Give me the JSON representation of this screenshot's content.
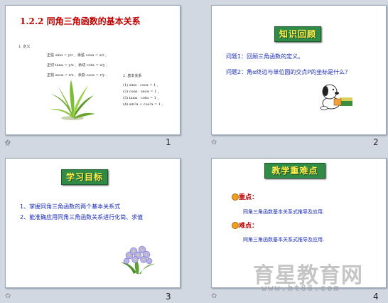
{
  "slides": [
    {
      "number": "1",
      "title": "1.2.2 同角三角函数的基本关系",
      "section1_label": "1. 定义",
      "definitions": [
        [
          "正弦 sinα = y/r ,",
          "余弦 cosα = x/r ,"
        ],
        [
          "正切 tanα = y/x ,",
          "余切 cotα = x/y ,"
        ],
        [
          "正割 secα = r/x ,",
          "余割 cscα = r/y ."
        ]
      ],
      "section2_label": "2. 基本关系",
      "relations": [
        "(1) sinα · cscα = 1 ,",
        "(2) cosα · secα = 1 ,",
        "(3) tanα · cotα = 1 ,",
        "(4) sin²α + cos²α = 1 ,"
      ]
    },
    {
      "number": "2",
      "badge": "知识回顾",
      "lines": [
        "问题1：回顾三角函数的定义。",
        "问题2：角α终边与单位圆的交点P的坐标是什么？"
      ]
    },
    {
      "number": "3",
      "badge": "学习目标",
      "lines": [
        "1、掌握同角三角函数的两个基本关系式",
        "2、能准确应用同角三角函数关系进行化简、求值"
      ]
    },
    {
      "number": "4",
      "badge": "教学重难点",
      "key_label": "重点：",
      "key_text": "同角三角函数基本关系式推导及应用.",
      "difficult_label": "难点：",
      "difficult_text": "同角三角函数基本关系式推导及应用."
    }
  ],
  "transition_icon": "star-transition-icon",
  "watermark": {
    "text": "育星教育网",
    "url": "www.ht88.com"
  },
  "colors": {
    "title_red": "#c00000",
    "badge_green": "#2f8b46",
    "badge_text": "#ffef4a",
    "text_blue": "#1a2bb8"
  }
}
